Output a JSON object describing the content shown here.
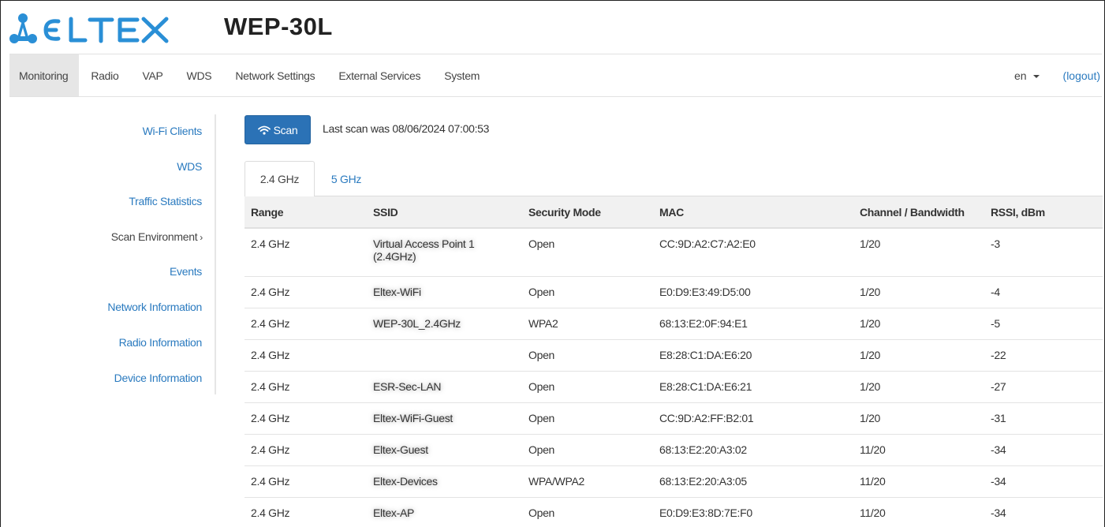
{
  "brand": {
    "logo_text": "ELTEX",
    "logo_color": "#2a8fd6",
    "product": "WEP-30L"
  },
  "nav": {
    "items": [
      {
        "label": "Monitoring",
        "active": true
      },
      {
        "label": "Radio"
      },
      {
        "label": "VAP"
      },
      {
        "label": "WDS"
      },
      {
        "label": "Network Settings"
      },
      {
        "label": "External Services"
      },
      {
        "label": "System"
      }
    ],
    "language": "en",
    "logout": "(logout)"
  },
  "sidebar": {
    "items": [
      {
        "label": "Wi-Fi Clients"
      },
      {
        "label": "WDS"
      },
      {
        "label": "Traffic Statistics"
      },
      {
        "label": "Scan Environment",
        "current": true,
        "chevron": "›"
      },
      {
        "label": "Events"
      },
      {
        "label": "Network Information"
      },
      {
        "label": "Radio Information"
      },
      {
        "label": "Device Information"
      }
    ]
  },
  "scan": {
    "button_label": "Scan",
    "button_icon": "wifi-icon",
    "last_scan": "Last scan was 08/06/2024 07:00:53"
  },
  "tabs": [
    {
      "label": "2.4 GHz",
      "active": true
    },
    {
      "label": "5 GHz"
    }
  ],
  "table": {
    "headers": [
      "Range",
      "SSID",
      "Security Mode",
      "MAC",
      "Channel / Bandwidth",
      "RSSI, dBm"
    ],
    "rows": [
      {
        "range": "2.4 GHz",
        "ssid": "Virtual Access Point 1 (2.4GHz)",
        "security": "Open",
        "mac": "CC:9D:A2:C7:A2:E0",
        "channel": "1/20",
        "rssi": "-3"
      },
      {
        "range": "2.4 GHz",
        "ssid": "Eltex-WiFi",
        "security": "Open",
        "mac": "E0:D9:E3:49:D5:00",
        "channel": "1/20",
        "rssi": "-4"
      },
      {
        "range": "2.4 GHz",
        "ssid": "WEP-30L_2.4GHz",
        "security": "WPA2",
        "mac": "68:13:E2:0F:94:E1",
        "channel": "1/20",
        "rssi": "-5"
      },
      {
        "range": "2.4 GHz",
        "ssid": "",
        "security": "Open",
        "mac": "E8:28:C1:DA:E6:20",
        "channel": "1/20",
        "rssi": "-22"
      },
      {
        "range": "2.4 GHz",
        "ssid": "ESR-Sec-LAN",
        "security": "Open",
        "mac": "E8:28:C1:DA:E6:21",
        "channel": "1/20",
        "rssi": "-27"
      },
      {
        "range": "2.4 GHz",
        "ssid": "Eltex-WiFi-Guest",
        "security": "Open",
        "mac": "CC:9D:A2:FF:B2:01",
        "channel": "1/20",
        "rssi": "-31"
      },
      {
        "range": "2.4 GHz",
        "ssid": "Eltex-Guest",
        "security": "Open",
        "mac": "68:13:E2:20:A3:02",
        "channel": "11/20",
        "rssi": "-34"
      },
      {
        "range": "2.4 GHz",
        "ssid": "Eltex-Devices",
        "security": "WPA/WPA2",
        "mac": "68:13:E2:20:A3:05",
        "channel": "11/20",
        "rssi": "-34"
      },
      {
        "range": "2.4 GHz",
        "ssid": "Eltex-AP",
        "security": "Open",
        "mac": "E0:D9:E3:8D:7E:F0",
        "channel": "11/20",
        "rssi": "-34"
      }
    ]
  }
}
